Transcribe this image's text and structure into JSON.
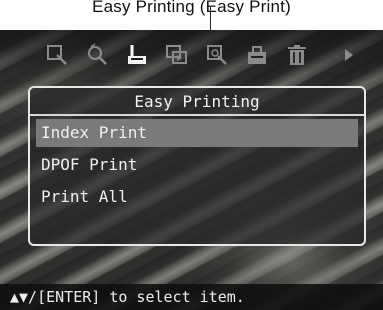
{
  "caption": {
    "text": "Easy Printing (Easy Print)"
  },
  "toolbar": {
    "icons": [
      {
        "name": "magnify-select-icon",
        "selected": false
      },
      {
        "name": "retouch-icon",
        "selected": false
      },
      {
        "name": "print-icon",
        "selected": true
      },
      {
        "name": "slideshow-icon",
        "selected": false
      },
      {
        "name": "zoom-icon",
        "selected": false
      },
      {
        "name": "save-icon",
        "selected": false
      },
      {
        "name": "trash-icon",
        "selected": false
      },
      {
        "name": "more-arrow-icon",
        "selected": false
      }
    ]
  },
  "menu": {
    "title": "Easy Printing",
    "items": [
      {
        "label": "Index Print",
        "selected": true
      },
      {
        "label": "DPOF Print",
        "selected": false
      },
      {
        "label": "Print All",
        "selected": false
      }
    ]
  },
  "status": {
    "text": "▲▼/[ENTER] to select item."
  },
  "colors": {
    "selection": "#7a7a7a",
    "frame": "#e8e8e8",
    "icon_dim": "#8a8a8a",
    "icon_active": "#f5f5f5"
  }
}
